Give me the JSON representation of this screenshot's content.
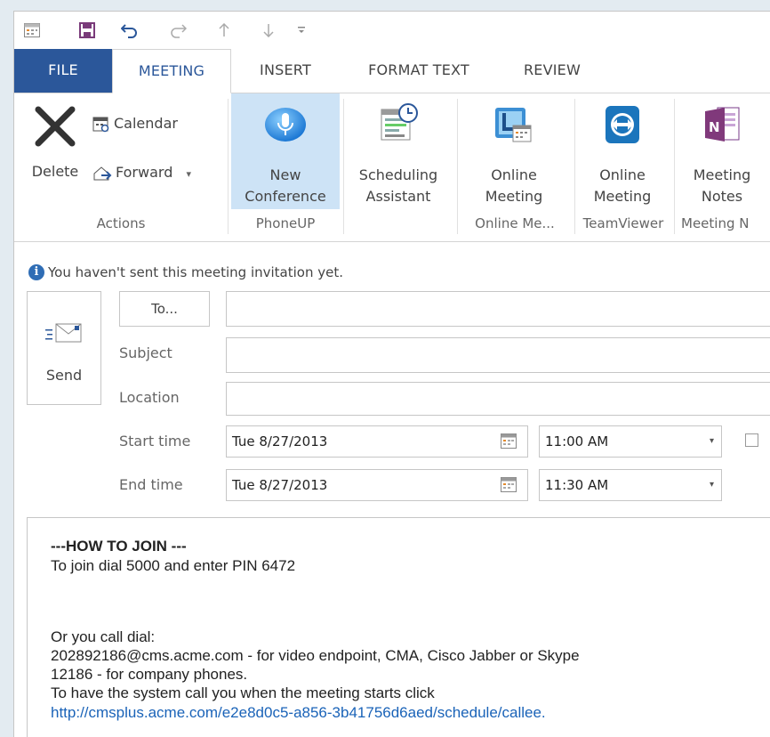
{
  "qat": {
    "icons": [
      "calendar-view-icon",
      "save-icon",
      "undo-icon",
      "redo-icon",
      "move-up-icon",
      "move-down-icon",
      "customize-icon"
    ]
  },
  "tabs": [
    {
      "label": "FILE"
    },
    {
      "label": "MEETING"
    },
    {
      "label": "INSERT"
    },
    {
      "label": "FORMAT TEXT"
    },
    {
      "label": "REVIEW"
    }
  ],
  "ribbon": {
    "actions": {
      "delete_label": "Delete",
      "calendar_label": "Calendar",
      "forward_label": "Forward",
      "forward_arrow": "▾",
      "group_label": "Actions"
    },
    "phoneup": {
      "button_label": "New\nConference",
      "group_label": "PhoneUP"
    },
    "scheduling": {
      "button_label": "Scheduling\nAssistant"
    },
    "online_meeting": {
      "button_label": "Online\nMeeting",
      "group_label": "Online Me..."
    },
    "teamviewer": {
      "button_label": "Online\nMeeting",
      "group_label": "TeamViewer"
    },
    "meeting_notes": {
      "button_label": "Meeting\nNotes",
      "group_label": "Meeting N"
    }
  },
  "info": {
    "message": "You haven't sent this meeting invitation yet."
  },
  "form": {
    "send_label": "Send",
    "to_label": "To...",
    "subject_label": "Subject",
    "location_label": "Location",
    "start_label": "Start time",
    "end_label": "End time",
    "start_date": "Tue 8/27/2013",
    "start_time": "11:00 AM",
    "end_date": "Tue 8/27/2013",
    "end_time": "11:30 AM",
    "time_arrow": "▾"
  },
  "body": {
    "heading": "---HOW TO JOIN ---",
    "line1": "To join dial 5000 and enter PIN 6472",
    "line2": "Or you call dial:",
    "line3": "202892186@cms.acme.com - for video endpoint, CMA, Cisco Jabber or Skype",
    "line4": "12186 - for company phones.",
    "line5": "To have the system call you when the meeting starts click",
    "link": "http://cmsplus.acme.com/e2e8d0c5-a856-3b41756d6aed/schedule/callee."
  },
  "colors": {
    "file_tab": "#2b579a",
    "active_tab_text": "#2b579a",
    "highlight": "#cde3f6",
    "link": "#1a63b8"
  }
}
